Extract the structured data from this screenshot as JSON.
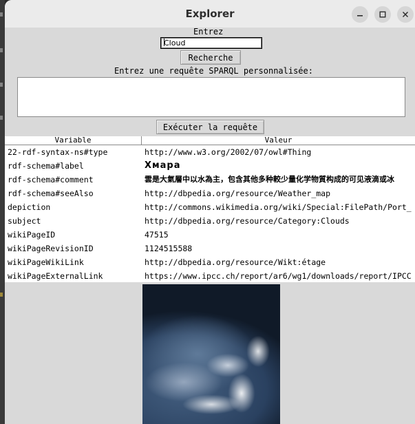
{
  "window": {
    "title": "Explorer"
  },
  "search": {
    "prompt_label": "Entrez",
    "value": "Cloud",
    "button_label": "Recherche"
  },
  "sparql": {
    "prompt_label": "Entrez une requête SPARQL personnalisée:",
    "query": "",
    "execute_label": "Exécuter la requête"
  },
  "results": {
    "columns": [
      "Variable",
      "Valeur"
    ],
    "rows": [
      {
        "variable": "22-rdf-syntax-ns#type",
        "value": "http://www.w3.org/2002/07/owl#Thing"
      },
      {
        "variable": "rdf-schema#label",
        "value": "Хмара"
      },
      {
        "variable": "rdf-schema#comment",
        "value": "雲是大氣層中以水為主，包含其他多种較少量化学物質构成的可见液滴或冰"
      },
      {
        "variable": "rdf-schema#seeAlso",
        "value": "http://dbpedia.org/resource/Weather_map"
      },
      {
        "variable": "depiction",
        "value": "http://commons.wikimedia.org/wiki/Special:FilePath/Port_"
      },
      {
        "variable": "subject",
        "value": "http://dbpedia.org/resource/Category:Clouds"
      },
      {
        "variable": "wikiPageID",
        "value": "47515"
      },
      {
        "variable": "wikiPageRevisionID",
        "value": "1124515588"
      },
      {
        "variable": "wikiPageWikiLink",
        "value": "http://dbpedia.org/resource/Wikt:étage"
      },
      {
        "variable": "wikiPageExternalLink",
        "value": "https://www.ipcc.ch/report/ar6/wg1/downloads/report/IPCC"
      }
    ]
  },
  "depiction_image": {
    "subject": "clouds seen from orbit over the ocean"
  }
}
